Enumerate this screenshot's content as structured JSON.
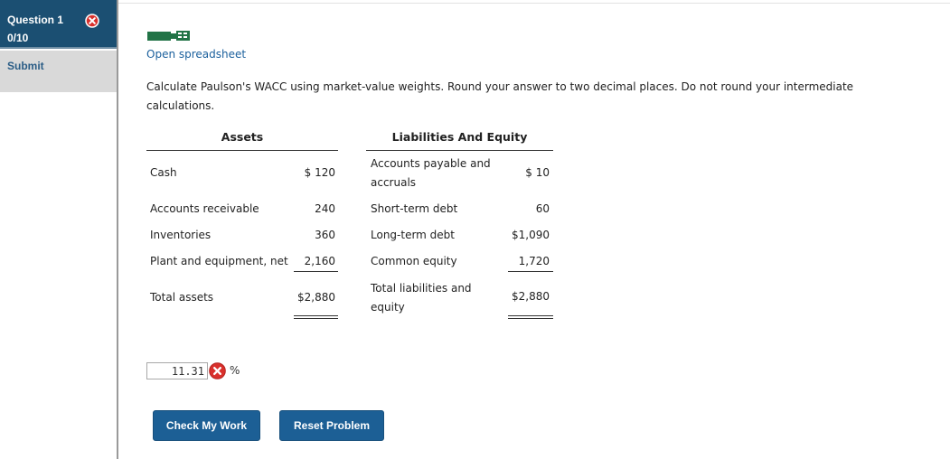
{
  "sidebar": {
    "question_title": "Question 1",
    "score": "0/10",
    "submit_label": "Submit",
    "status_icon": "incorrect-x-icon"
  },
  "main": {
    "spreadsheet_link": "Open spreadsheet",
    "instructions": "Calculate Paulson's WACC using market-value weights. Round your answer to two decimal places. Do not round your intermediate calculations.",
    "assets_header": "Assets",
    "liabilities_header": "Liabilities And Equity",
    "assets": [
      {
        "label": "Cash",
        "value": "$ 120"
      },
      {
        "label": "Accounts receivable",
        "value": "240"
      },
      {
        "label": "Inventories",
        "value": "360"
      },
      {
        "label": "Plant and equipment, net",
        "value": "2,160"
      }
    ],
    "assets_total": {
      "label": "Total assets",
      "value": "$2,880"
    },
    "liabilities": [
      {
        "label_line1": "Accounts payable and",
        "label_line2": "accruals",
        "value": "$ 10"
      },
      {
        "label": "Short-term debt",
        "value": "60"
      },
      {
        "label": "Long-term debt",
        "value": "$1,090"
      },
      {
        "label": "Common equity",
        "value": "1,720"
      }
    ],
    "liabilities_total": {
      "label_line1": "Total liabilities and",
      "label_line2": "equity",
      "value": "$2,880"
    },
    "answer_value": "11.31",
    "answer_unit": "%",
    "check_button": "Check My Work",
    "reset_button": "Reset Problem"
  },
  "colors": {
    "header_bg": "#1b4f72",
    "button_bg": "#1c5f95",
    "link": "#1a5f9c",
    "error_red": "#d9302c",
    "sheet_icon_green": "#217346"
  }
}
